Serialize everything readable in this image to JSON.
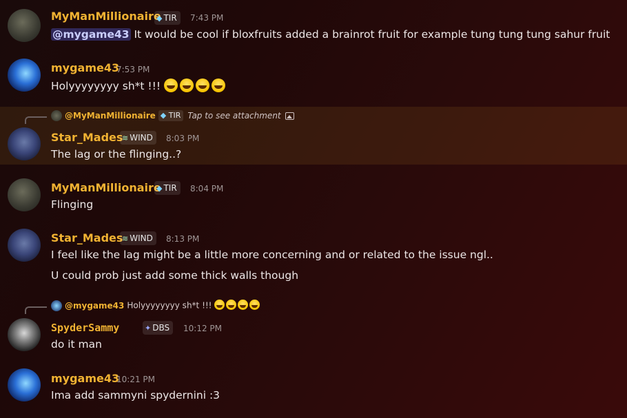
{
  "colors": {
    "username": "#f0b232",
    "mention_bg": "#5865f2",
    "highlight_bg": "#f0b232"
  },
  "messages": [
    {
      "author": "MyManMillionaire",
      "tag_icon": "gem-icon",
      "tag": "TIR",
      "time": "7:43 PM",
      "mention": "@mygame43",
      "text": " It would be cool if bloxfruits added a brainrot fruit for example tung tung tung sahur fruit"
    },
    {
      "author": "mygame43",
      "time": "7:53 PM",
      "text": "Holyyyyyyyy sh*t !!! ",
      "emojis": [
        "😂",
        "😂",
        "😂",
        "😂"
      ]
    },
    {
      "reply": {
        "name": "@MyManMillionaire",
        "tag": "TIR",
        "text": "Tap to see attachment"
      },
      "author": "Star_Mades",
      "tag_icon": "wind-icon",
      "tag": "WIND",
      "time": "8:03 PM",
      "text": "The lag or the flinging..?"
    },
    {
      "author": "MyManMillionaire",
      "tag_icon": "gem-icon",
      "tag": "TIR",
      "time": "8:04 PM",
      "text": "Flinging"
    },
    {
      "author": "Star_Mades",
      "tag_icon": "wind-icon",
      "tag": "WIND",
      "time": "8:13 PM",
      "text": "I feel like the lag might be a little more concerning and or related to the issue ngl..",
      "text2": "U could prob just add some thick walls though"
    },
    {
      "reply": {
        "name": "@mygame43",
        "text": "Holyyyyyyyy sh*t !!!"
      },
      "author": "SpyderSammy",
      "tag_icon": "diamond-icon",
      "tag": "DBS",
      "time": "10:12 PM",
      "text": "do it man"
    },
    {
      "author": "mygame43",
      "time": "10:21 PM",
      "text": "Ima add sammyni spydernini :3"
    }
  ]
}
